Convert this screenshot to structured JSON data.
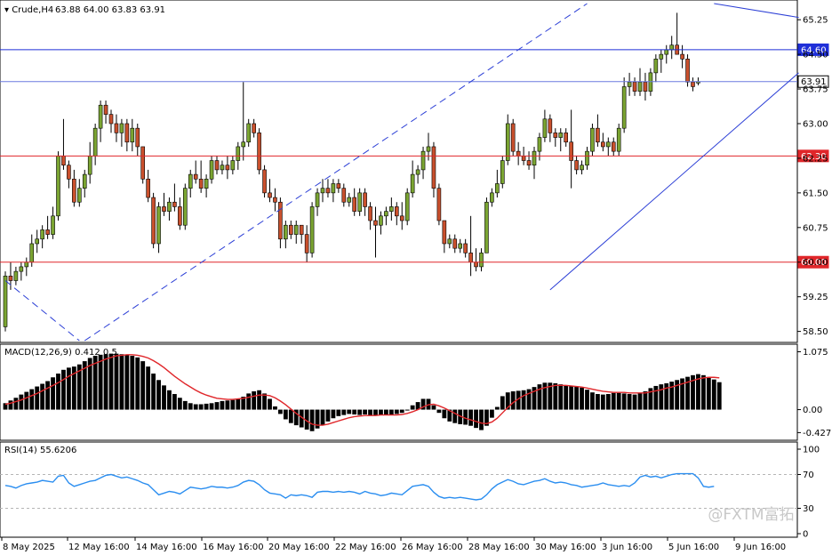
{
  "chart_data": [
    {
      "panel": "price",
      "type": "candlestick",
      "title": "Crude,H4",
      "ohlc_header": "63.88 64.00 63.83 63.91",
      "ylim": [
        58.3,
        65.6
      ],
      "y_ticks": [
        "65.25",
        "64.50",
        "63.75",
        "63.00",
        "62.25",
        "61.50",
        "60.75",
        "60.00",
        "59.25",
        "58.50"
      ],
      "x_ticks": [
        "8 May 2025",
        "12 May 16:00",
        "14 May 16:00",
        "16 May 16:00",
        "20 May 16:00",
        "22 May 16:00",
        "26 May 16:00",
        "28 May 16:00",
        "30 May 16:00",
        "3 Jun 16:00",
        "5 Jun 16:00",
        "9 Jun 16:00"
      ],
      "up_color": "#7ba532",
      "down_color": "#c9502d",
      "candles": [
        [
          58.6,
          59.8,
          58.5,
          59.7
        ],
        [
          59.7,
          60.0,
          59.4,
          59.6
        ],
        [
          59.6,
          59.9,
          59.5,
          59.8
        ],
        [
          59.8,
          60.0,
          59.6,
          59.9
        ],
        [
          59.9,
          60.1,
          59.7,
          60.0
        ],
        [
          60.0,
          60.6,
          59.9,
          60.4
        ],
        [
          60.4,
          60.7,
          60.2,
          60.5
        ],
        [
          60.5,
          60.8,
          60.3,
          60.7
        ],
        [
          60.7,
          61.0,
          60.5,
          60.6
        ],
        [
          60.6,
          61.2,
          60.5,
          61.0
        ],
        [
          61.0,
          62.4,
          60.9,
          62.3
        ],
        [
          62.3,
          63.1,
          62.0,
          62.1
        ],
        [
          62.1,
          62.2,
          61.6,
          61.8
        ],
        [
          61.8,
          62.0,
          61.2,
          61.3
        ],
        [
          61.3,
          61.8,
          61.2,
          61.6
        ],
        [
          61.6,
          62.0,
          61.4,
          61.9
        ],
        [
          61.9,
          62.6,
          61.7,
          62.3
        ],
        [
          62.3,
          63.0,
          62.1,
          62.9
        ],
        [
          62.9,
          63.5,
          62.6,
          63.4
        ],
        [
          63.4,
          63.5,
          63.0,
          63.2
        ],
        [
          63.2,
          63.3,
          62.8,
          63.0
        ],
        [
          63.0,
          63.2,
          62.6,
          62.8
        ],
        [
          62.8,
          63.1,
          62.5,
          63.0
        ],
        [
          63.0,
          63.1,
          62.4,
          62.6
        ],
        [
          62.6,
          63.1,
          62.4,
          62.9
        ],
        [
          62.9,
          63.0,
          62.3,
          62.5
        ],
        [
          62.5,
          62.5,
          61.7,
          61.8
        ],
        [
          61.8,
          62.0,
          61.3,
          61.4
        ],
        [
          61.4,
          61.5,
          60.3,
          60.4
        ],
        [
          60.4,
          61.3,
          60.2,
          61.2
        ],
        [
          61.2,
          61.5,
          61.0,
          61.1
        ],
        [
          61.1,
          61.4,
          60.9,
          61.3
        ],
        [
          61.3,
          61.7,
          61.1,
          61.2
        ],
        [
          61.2,
          61.4,
          60.7,
          60.8
        ],
        [
          60.8,
          61.7,
          60.7,
          61.6
        ],
        [
          61.6,
          62.0,
          61.4,
          61.9
        ],
        [
          61.9,
          62.2,
          61.7,
          61.8
        ],
        [
          61.8,
          62.2,
          61.5,
          61.6
        ],
        [
          61.6,
          61.9,
          61.4,
          61.8
        ],
        [
          61.8,
          62.3,
          61.7,
          62.2
        ],
        [
          62.2,
          62.3,
          61.9,
          62.0
        ],
        [
          62.0,
          62.2,
          61.9,
          62.1
        ],
        [
          62.1,
          62.3,
          61.8,
          62.0
        ],
        [
          62.0,
          62.3,
          61.9,
          62.2
        ],
        [
          62.2,
          62.6,
          62.0,
          62.5
        ],
        [
          62.5,
          63.9,
          62.2,
          62.6
        ],
        [
          62.6,
          63.1,
          62.5,
          63.0
        ],
        [
          63.0,
          63.1,
          62.7,
          62.8
        ],
        [
          62.8,
          62.9,
          61.9,
          62.0
        ],
        [
          62.0,
          62.1,
          61.4,
          61.5
        ],
        [
          61.5,
          61.8,
          61.3,
          61.4
        ],
        [
          61.4,
          61.6,
          61.1,
          61.3
        ],
        [
          61.3,
          61.4,
          60.3,
          60.5
        ],
        [
          60.5,
          60.9,
          60.3,
          60.8
        ],
        [
          60.8,
          60.9,
          60.5,
          60.6
        ],
        [
          60.6,
          60.9,
          60.4,
          60.8
        ],
        [
          60.8,
          60.8,
          60.4,
          60.6
        ],
        [
          60.6,
          60.8,
          60.0,
          60.2
        ],
        [
          60.2,
          61.3,
          60.1,
          61.2
        ],
        [
          61.2,
          61.6,
          61.0,
          61.5
        ],
        [
          61.5,
          61.8,
          61.3,
          61.6
        ],
        [
          61.6,
          61.8,
          61.4,
          61.5
        ],
        [
          61.5,
          61.8,
          61.3,
          61.7
        ],
        [
          61.7,
          61.8,
          61.5,
          61.6
        ],
        [
          61.6,
          61.7,
          61.2,
          61.3
        ],
        [
          61.3,
          61.5,
          61.2,
          61.4
        ],
        [
          61.4,
          61.6,
          61.0,
          61.1
        ],
        [
          61.1,
          61.6,
          61.0,
          61.5
        ],
        [
          61.5,
          61.6,
          61.0,
          61.2
        ],
        [
          61.2,
          61.3,
          60.7,
          60.9
        ],
        [
          60.9,
          61.2,
          60.1,
          60.8
        ],
        [
          60.8,
          61.1,
          60.6,
          61.0
        ],
        [
          61.0,
          61.2,
          60.8,
          61.1
        ],
        [
          61.1,
          61.4,
          60.9,
          61.2
        ],
        [
          61.2,
          61.3,
          60.8,
          61.0
        ],
        [
          61.0,
          61.3,
          60.7,
          60.9
        ],
        [
          60.9,
          61.6,
          60.8,
          61.5
        ],
        [
          61.5,
          62.2,
          61.4,
          61.9
        ],
        [
          61.9,
          62.1,
          61.7,
          62.0
        ],
        [
          62.0,
          62.5,
          61.8,
          62.4
        ],
        [
          62.4,
          62.8,
          62.2,
          62.5
        ],
        [
          62.5,
          62.6,
          61.4,
          61.6
        ],
        [
          61.6,
          61.7,
          60.8,
          60.9
        ],
        [
          60.9,
          60.9,
          60.2,
          60.4
        ],
        [
          60.4,
          60.6,
          60.3,
          60.5
        ],
        [
          60.5,
          60.6,
          60.2,
          60.3
        ],
        [
          60.3,
          60.5,
          60.2,
          60.4
        ],
        [
          60.4,
          60.5,
          60.1,
          60.2
        ],
        [
          60.2,
          61.0,
          59.7,
          60.0
        ],
        [
          60.0,
          60.3,
          59.8,
          59.9
        ],
        [
          59.9,
          60.3,
          59.8,
          60.2
        ],
        [
          60.2,
          61.4,
          60.2,
          61.3
        ],
        [
          61.3,
          61.6,
          61.2,
          61.5
        ],
        [
          61.5,
          62.0,
          61.4,
          61.7
        ],
        [
          61.7,
          62.3,
          61.6,
          62.2
        ],
        [
          62.2,
          63.2,
          62.1,
          63.0
        ],
        [
          63.0,
          63.1,
          62.3,
          62.4
        ],
        [
          62.4,
          62.6,
          62.1,
          62.3
        ],
        [
          62.3,
          62.5,
          62.1,
          62.2
        ],
        [
          62.2,
          62.4,
          62.0,
          62.1
        ],
        [
          62.1,
          62.5,
          61.8,
          62.4
        ],
        [
          62.4,
          62.8,
          62.2,
          62.7
        ],
        [
          62.7,
          63.3,
          62.6,
          63.1
        ],
        [
          63.1,
          63.2,
          62.6,
          62.8
        ],
        [
          62.8,
          62.9,
          62.5,
          62.7
        ],
        [
          62.7,
          62.9,
          62.4,
          62.8
        ],
        [
          62.8,
          62.9,
          62.5,
          62.6
        ],
        [
          62.6,
          63.3,
          61.6,
          62.2
        ],
        [
          62.2,
          62.3,
          61.9,
          62.0
        ],
        [
          62.0,
          62.2,
          61.9,
          62.1
        ],
        [
          62.1,
          62.5,
          62.0,
          62.4
        ],
        [
          62.4,
          63.0,
          62.3,
          62.9
        ],
        [
          62.9,
          63.2,
          62.5,
          62.6
        ],
        [
          62.6,
          62.8,
          62.4,
          62.5
        ],
        [
          62.5,
          62.7,
          62.3,
          62.6
        ],
        [
          62.6,
          62.7,
          62.3,
          62.4
        ],
        [
          62.4,
          63.0,
          62.3,
          62.9
        ],
        [
          62.9,
          64.0,
          62.8,
          63.8
        ],
        [
          63.8,
          64.1,
          63.6,
          63.9
        ],
        [
          63.9,
          64.0,
          63.6,
          63.7
        ],
        [
          63.7,
          64.2,
          63.6,
          63.9
        ],
        [
          63.9,
          64.1,
          63.5,
          63.7
        ],
        [
          63.7,
          64.2,
          63.6,
          64.1
        ],
        [
          64.1,
          64.5,
          63.9,
          64.4
        ],
        [
          64.4,
          64.6,
          64.1,
          64.5
        ],
        [
          64.5,
          64.7,
          64.3,
          64.6
        ],
        [
          64.6,
          64.9,
          64.4,
          64.7
        ],
        [
          64.7,
          65.4,
          64.5,
          64.5
        ],
        [
          64.5,
          64.7,
          64.2,
          64.4
        ],
        [
          64.4,
          64.5,
          63.8,
          63.9
        ],
        [
          63.9,
          64.0,
          63.7,
          63.8
        ],
        [
          63.88,
          64.0,
          63.83,
          63.91
        ]
      ],
      "horizontal_lines": [
        {
          "label": "64.60",
          "value": 64.6,
          "color": "#1f2fd8"
        },
        {
          "label": "63.91",
          "value": 63.91,
          "color": "#6b7adf"
        },
        {
          "label": "62.30",
          "value": 62.3,
          "color": "#e0262a"
        },
        {
          "label": "60.00",
          "value": 60.0,
          "color": "#e0262a"
        }
      ],
      "trend_lines": [
        {
          "from": [
            0,
            59.6
          ],
          "to": [
            14,
            58.3
          ],
          "style": "dashed",
          "color": "#2c3fd6"
        },
        {
          "from": [
            15,
            58.3
          ],
          "to": [
            110,
            65.6
          ],
          "style": "dashed",
          "color": "#2c3fd6"
        },
        {
          "from": [
            103,
            59.4
          ],
          "to": [
            150,
            64.1
          ],
          "style": "solid",
          "color": "#2c3fd6"
        },
        {
          "from": [
            134,
            65.6
          ],
          "to": [
            150,
            65.3
          ],
          "style": "solid",
          "color": "#2c3fd6"
        }
      ]
    },
    {
      "panel": "macd",
      "type": "bar",
      "title": "MACD(12,26,9) 0.412 0.5",
      "ylim": [
        -0.47,
        1.1
      ],
      "y_ticks": [
        "1.075",
        "0.00",
        "-0.427"
      ],
      "bar_color": "#000000",
      "signal_color": "#e0262a",
      "histogram": [
        0.12,
        0.17,
        0.22,
        0.28,
        0.33,
        0.38,
        0.43,
        0.48,
        0.53,
        0.6,
        0.67,
        0.74,
        0.78,
        0.8,
        0.84,
        0.9,
        0.96,
        1.0,
        1.02,
        1.03,
        1.04,
        1.04,
        1.03,
        1.02,
        1.0,
        0.97,
        0.9,
        0.8,
        0.67,
        0.55,
        0.45,
        0.36,
        0.29,
        0.22,
        0.16,
        0.12,
        0.1,
        0.1,
        0.11,
        0.12,
        0.14,
        0.16,
        0.17,
        0.18,
        0.2,
        0.24,
        0.3,
        0.34,
        0.36,
        0.3,
        0.2,
        0.06,
        -0.08,
        -0.18,
        -0.25,
        -0.29,
        -0.33,
        -0.37,
        -0.4,
        -0.35,
        -0.28,
        -0.22,
        -0.16,
        -0.12,
        -0.1,
        -0.08,
        -0.09,
        -0.1,
        -0.09,
        -0.1,
        -0.11,
        -0.1,
        -0.09,
        -0.1,
        -0.08,
        -0.06,
        0.0,
        0.08,
        0.14,
        0.2,
        0.2,
        0.08,
        -0.06,
        -0.16,
        -0.22,
        -0.25,
        -0.27,
        -0.28,
        -0.3,
        -0.34,
        -0.38,
        -0.3,
        -0.15,
        0.05,
        0.25,
        0.32,
        0.34,
        0.35,
        0.36,
        0.38,
        0.42,
        0.47,
        0.5,
        0.5,
        0.49,
        0.47,
        0.45,
        0.44,
        0.43,
        0.41,
        0.37,
        0.32,
        0.29,
        0.28,
        0.29,
        0.31,
        0.31,
        0.3,
        0.29,
        0.28,
        0.3,
        0.34,
        0.4,
        0.44,
        0.47,
        0.49,
        0.52,
        0.55,
        0.58,
        0.61,
        0.64,
        0.66,
        0.64,
        0.6,
        0.56,
        0.51
      ],
      "signal": [
        0.1,
        0.12,
        0.15,
        0.18,
        0.22,
        0.26,
        0.3,
        0.35,
        0.4,
        0.45,
        0.5,
        0.56,
        0.62,
        0.67,
        0.72,
        0.77,
        0.82,
        0.86,
        0.9,
        0.94,
        0.97,
        1.0,
        1.01,
        1.02,
        1.02,
        1.01,
        0.99,
        0.96,
        0.91,
        0.85,
        0.78,
        0.7,
        0.62,
        0.55,
        0.48,
        0.42,
        0.36,
        0.31,
        0.27,
        0.24,
        0.21,
        0.2,
        0.19,
        0.19,
        0.2,
        0.21,
        0.23,
        0.25,
        0.27,
        0.27,
        0.26,
        0.22,
        0.16,
        0.09,
        0.01,
        -0.07,
        -0.14,
        -0.21,
        -0.27,
        -0.29,
        -0.29,
        -0.27,
        -0.24,
        -0.21,
        -0.18,
        -0.15,
        -0.13,
        -0.12,
        -0.11,
        -0.11,
        -0.11,
        -0.1,
        -0.1,
        -0.1,
        -0.1,
        -0.09,
        -0.07,
        -0.04,
        0.0,
        0.05,
        0.09,
        0.1,
        0.07,
        0.03,
        -0.02,
        -0.07,
        -0.12,
        -0.16,
        -0.19,
        -0.22,
        -0.25,
        -0.26,
        -0.23,
        -0.16,
        -0.06,
        0.04,
        0.13,
        0.2,
        0.26,
        0.3,
        0.34,
        0.38,
        0.41,
        0.43,
        0.45,
        0.45,
        0.45,
        0.44,
        0.43,
        0.42,
        0.4,
        0.38,
        0.36,
        0.34,
        0.33,
        0.32,
        0.32,
        0.32,
        0.31,
        0.31,
        0.31,
        0.31,
        0.33,
        0.35,
        0.37,
        0.4,
        0.42,
        0.45,
        0.48,
        0.51,
        0.54,
        0.57,
        0.59,
        0.6,
        0.6,
        0.59
      ]
    },
    {
      "panel": "rsi",
      "type": "line",
      "title": "RSI(14) 55.6206",
      "ylim": [
        0,
        100
      ],
      "y_ticks": [
        "100",
        "70",
        "30",
        "0"
      ],
      "levels": [
        70,
        30
      ],
      "line_color": "#2b8ef0",
      "values": [
        57,
        56,
        54,
        57,
        59,
        60,
        61,
        63,
        62,
        61,
        68,
        69,
        60,
        56,
        58,
        60,
        62,
        63,
        66,
        69,
        70,
        68,
        66,
        67,
        65,
        63,
        60,
        58,
        52,
        46,
        48,
        50,
        49,
        47,
        51,
        55,
        54,
        53,
        54,
        56,
        55,
        55,
        54,
        55,
        57,
        61,
        63,
        62,
        58,
        52,
        48,
        47,
        46,
        42,
        46,
        45,
        46,
        45,
        43,
        49,
        50,
        50,
        49,
        50,
        49,
        50,
        49,
        47,
        50,
        48,
        47,
        45,
        46,
        48,
        47,
        46,
        51,
        56,
        57,
        58,
        56,
        49,
        44,
        42,
        43,
        42,
        43,
        42,
        41,
        40,
        41,
        46,
        53,
        58,
        61,
        64,
        62,
        59,
        58,
        60,
        62,
        63,
        65,
        62,
        60,
        61,
        60,
        58,
        57,
        55,
        56,
        57,
        58,
        60,
        58,
        57,
        56,
        57,
        56,
        60,
        67,
        69,
        67,
        68,
        66,
        68,
        70,
        71,
        71,
        71,
        71,
        66,
        56,
        55,
        56
      ]
    }
  ],
  "watermark": "@FXTM富拓"
}
